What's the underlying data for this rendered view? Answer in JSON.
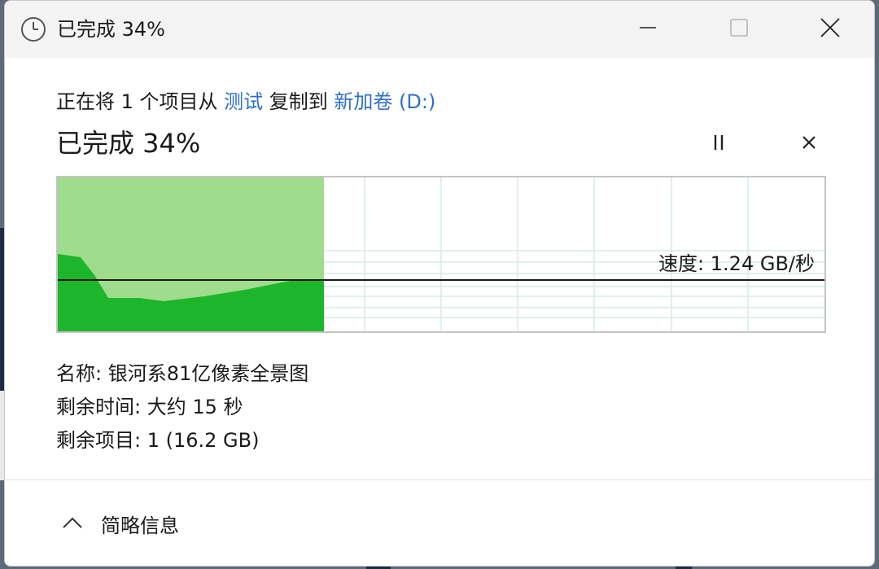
{
  "window": {
    "title": "已完成 34%",
    "minimize_icon": "minimize-icon",
    "maximize_icon": "maximize-icon",
    "close_icon": "close-icon"
  },
  "copy": {
    "prefix": "正在将 1 个项目从 ",
    "source": "测试",
    "middle": " 复制到 ",
    "destination": "新加卷 (D:)"
  },
  "progress": {
    "title": "已完成 34%",
    "percent": 34,
    "pause_icon": "pause-icon",
    "cancel_icon": "cancel-icon"
  },
  "graph": {
    "speed_label": "速度: 1.24 GB/秒",
    "fill_color": "#9fdc8c",
    "throughput_color": "#1db52c",
    "grid_color": "#d6ebe6"
  },
  "details": {
    "name": "名称: 银河系81亿像素全景图",
    "time_remaining": "剩余时间: 大约 15 秒",
    "items_remaining": "剩余项目: 1 (16.2 GB)"
  },
  "footer": {
    "toggle_label": "简略信息",
    "toggle_icon": "chevron-up-icon"
  }
}
